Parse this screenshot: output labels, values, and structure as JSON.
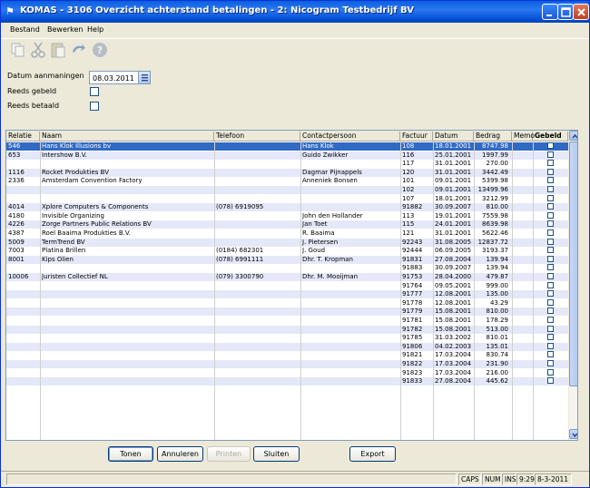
{
  "window": {
    "title": "KOMAS - 3106 Overzicht achterstand betalingen - 2: Nicogram Testbedrijf BV"
  },
  "menu": [
    "Bestand",
    "Bewerken",
    "Help"
  ],
  "toolbar": {
    "icons": [
      "copy-icon",
      "cut-icon",
      "paste-icon",
      "undo-icon",
      "help-icon"
    ]
  },
  "form": {
    "date_label": "Datum aanmaningen",
    "date_value": "08.03.2011",
    "reeds_gebeld_label": "Reeds gebeld",
    "reeds_betaald_label": "Reeds betaald"
  },
  "grid": {
    "columns": [
      "Relatie",
      "Naam",
      "Telefoon",
      "Contactpersoon",
      "Factuur",
      "Datum",
      "Bedrag",
      "Memo",
      "Gebeld"
    ],
    "rows": [
      [
        "546",
        "Hans Klok Illusions bv",
        "",
        "Hans Klok",
        "108",
        "18.01.2001",
        "8747.98"
      ],
      [
        "653",
        "Intershow B.V.",
        "",
        "Guido Zwikker",
        "116",
        "25.01.2001",
        "1997.99"
      ],
      [
        "",
        "",
        "",
        "",
        "117",
        "31.01.2001",
        "270.00"
      ],
      [
        "1116",
        "Rocket Produkties BV",
        "",
        "Dagmar Pijnappels",
        "120",
        "31.01.2001",
        "3442.49"
      ],
      [
        "2336",
        "Amsterdam Convention Factory",
        "",
        "Anneniek Bonsen",
        "101",
        "09.01.2001",
        "5399.98"
      ],
      [
        "",
        "",
        "",
        "",
        "102",
        "09.01.2001",
        "13499.96"
      ],
      [
        "",
        "",
        "",
        "",
        "107",
        "18.01.2001",
        "3212.99"
      ],
      [
        "4014",
        "Xplore Computers & Components",
        "(078) 6919095",
        "",
        "91882",
        "30.09.2007",
        "810.00"
      ],
      [
        "4180",
        "Invisible Organizing",
        "",
        "John den Hollander",
        "113",
        "19.01.2001",
        "7559.98"
      ],
      [
        "4226",
        "Zorge Partners Public Relations BV",
        "",
        "Jan Toet",
        "115",
        "24.01.2001",
        "8639.98"
      ],
      [
        "4387",
        "Roel Baaima Produkties B.V.",
        "",
        "R. Baaima",
        "121",
        "31.01.2001",
        "5622.46"
      ],
      [
        "5009",
        "TermTrend BV",
        "",
        "J. Pietersen",
        "92243",
        "31.08.2005",
        "12837.72"
      ],
      [
        "7003",
        "Platina Brillen",
        "(0184) 682301",
        "J. Goud",
        "92444",
        "06.09.2005",
        "3193.37"
      ],
      [
        "8001",
        "Kips Olien",
        "(078) 6991111",
        "Dhr. T. Kropman",
        "91831",
        "27.08.2004",
        "139.94"
      ],
      [
        "",
        "",
        "",
        "",
        "91883",
        "30.09.2007",
        "139.94"
      ],
      [
        "10006",
        "Juristen Collectief NL",
        "(079) 3300790",
        "Dhr. M. Mooijman",
        "91753",
        "28.04.2000",
        "479.87"
      ],
      [
        "",
        "",
        "",
        "",
        "91764",
        "09.05.2001",
        "999.00"
      ],
      [
        "",
        "",
        "",
        "",
        "91777",
        "12.08.2001",
        "135.00"
      ],
      [
        "",
        "",
        "",
        "",
        "91778",
        "12.08.2001",
        "43.29"
      ],
      [
        "",
        "",
        "",
        "",
        "91779",
        "15.08.2001",
        "810.00"
      ],
      [
        "",
        "",
        "",
        "",
        "91781",
        "15.08.2001",
        "178.29"
      ],
      [
        "",
        "",
        "",
        "",
        "91782",
        "15.08.2001",
        "513.00"
      ],
      [
        "",
        "",
        "",
        "",
        "91785",
        "31.03.2002",
        "810.01"
      ],
      [
        "",
        "",
        "",
        "",
        "91806",
        "04.02.2003",
        "135.01"
      ],
      [
        "",
        "",
        "",
        "",
        "91821",
        "17.03.2004",
        "830.74"
      ],
      [
        "",
        "",
        "",
        "",
        "91822",
        "17.03.2004",
        "231.90"
      ],
      [
        "",
        "",
        "",
        "",
        "91823",
        "17.03.2004",
        "216.00"
      ],
      [
        "",
        "",
        "",
        "",
        "91833",
        "27.08.2004",
        "445.62"
      ]
    ]
  },
  "buttons": {
    "tonen": "Tonen",
    "annuleren": "Annuleren",
    "printen": "Printen",
    "sluiten": "Sluiten",
    "export": "Export"
  },
  "status": {
    "caps": "CAPS",
    "num": "NUM",
    "ins": "INS",
    "time": "9:29",
    "date": "8-3-2011"
  }
}
